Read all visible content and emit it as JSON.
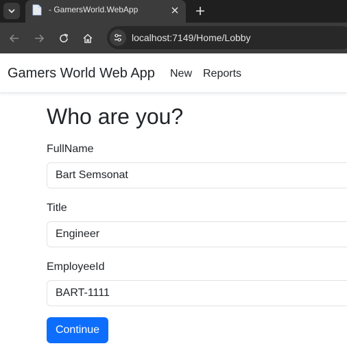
{
  "browser": {
    "tab_title": "- GamersWorld.WebApp",
    "url": "localhost:7149/Home/Lobby",
    "icons": [
      "tab-search-icon",
      "page-favicon-icon",
      "close-icon",
      "plus-icon",
      "back-arrow-icon",
      "forward-arrow-icon",
      "reload-icon",
      "home-icon",
      "site-info-icon"
    ]
  },
  "navbar": {
    "brand": "Gamers World Web App",
    "links": [
      "New",
      "Reports"
    ]
  },
  "form": {
    "title": "Who are you?",
    "fields": [
      {
        "label": "FullName",
        "value": "Bart Semsonat"
      },
      {
        "label": "Title",
        "value": "Engineer"
      },
      {
        "label": "EmployeeId",
        "value": "BART-1111"
      }
    ],
    "submit_label": "Continue"
  },
  "colors": {
    "primary": "#0d6efd",
    "browser_frame": "#1f1f1f",
    "browser_toolbar": "#3c3c3c",
    "text": "#212529"
  }
}
